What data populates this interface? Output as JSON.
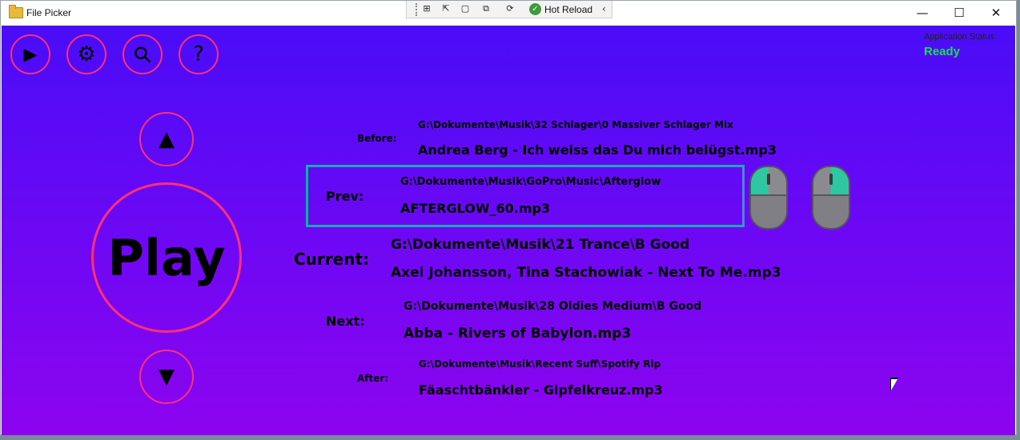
{
  "window": {
    "title": "File Picker",
    "minimize_glyph": "—",
    "maximize_glyph": "☐",
    "close_glyph": "✕"
  },
  "devtools": {
    "tools": [
      "⊞",
      "⇱",
      "▢",
      "⧉",
      "⟳"
    ],
    "check_glyph": "✓",
    "hot_reload_label": "Hot Reload",
    "collapse_glyph": "‹"
  },
  "toolbar": {
    "play_glyph": "▶",
    "settings_glyph": "⚙",
    "search_glyph": "⚲",
    "help_glyph": "?"
  },
  "status": {
    "label": "Application Status:",
    "value": "Ready"
  },
  "controls": {
    "up_glyph": "▲",
    "play_label": "Play",
    "down_glyph": "▼"
  },
  "queue": {
    "before": {
      "label": "Before:",
      "path": "G:\\Dokumente\\Musik\\32 Schlager\\0 Massiver Schlager Mix",
      "file": "Andrea Berg - Ich weiss das Du mich belügst.mp3"
    },
    "prev": {
      "label": "Prev:",
      "path": "G:\\Dokumente\\Musik\\GoPro\\Music\\Afterglow",
      "file": "AFTERGLOW_60.mp3"
    },
    "current": {
      "label": "Current:",
      "path": "G:\\Dokumente\\Musik\\21 Trance\\B Good",
      "file": "Axel Johansson, Tina Stachowiak - Next To Me.mp3"
    },
    "next": {
      "label": "Next:",
      "path": "G:\\Dokumente\\Musik\\28 Oldies Medium\\B Good",
      "file": "Abba - Rivers of Babylon.mp3"
    },
    "after": {
      "label": "After:",
      "path": "G:\\Dokumente\\Musik\\Recent Suff\\Spotify Rip",
      "file": "Fäaschtbänkler - Gipfelkreuz.mp3"
    }
  },
  "colors": {
    "accent_ring": "#ff2f77",
    "status_ready": "#12e54a",
    "selection_border": "#1aa9b2",
    "mouse_active": "#2fc7a1"
  }
}
